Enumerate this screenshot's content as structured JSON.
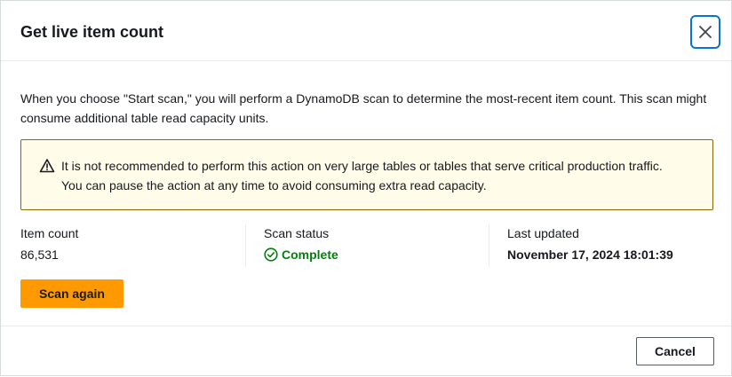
{
  "modal": {
    "title": "Get live item count",
    "close_icon": "close-icon"
  },
  "description": "When you choose \"Start scan,\" you will perform a DynamoDB scan to determine the most-recent item count. This scan might consume additional table read capacity units.",
  "alert": {
    "icon": "warning-icon",
    "text": "It is not recommended to perform this action on very large tables or tables that serve critical production traffic. You can pause the action at any time to avoid consuming extra read capacity."
  },
  "stats": {
    "item_count_label": "Item count",
    "item_count_value": "86,531",
    "scan_status_label": "Scan status",
    "scan_status_value": "Complete",
    "scan_status_icon": "check-circle-icon",
    "last_updated_label": "Last updated",
    "last_updated_value": "November 17, 2024 18:01:39"
  },
  "buttons": {
    "scan_again": "Scan again",
    "cancel": "Cancel"
  },
  "colors": {
    "accent": "#0972d3",
    "primary_button": "#ff9900",
    "success": "#037f0c",
    "warning_bg": "#fffce9",
    "warning_border": "#8d6605"
  }
}
